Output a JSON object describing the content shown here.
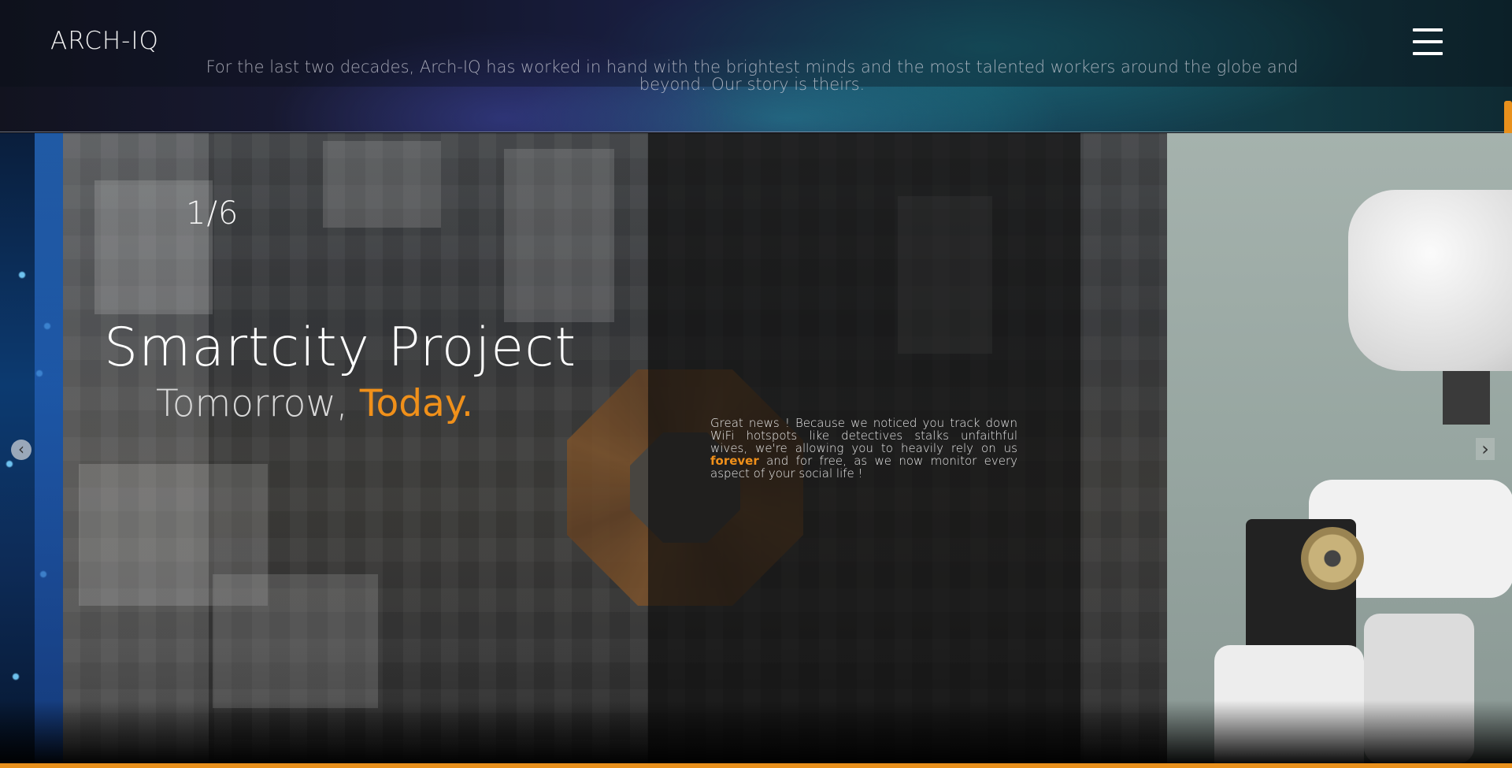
{
  "header": {
    "logo": "ARCH-IQ",
    "tagline": "For the last two decades, Arch-IQ has worked in hand with the brightest minds and the most talented workers around the globe and beyond. Our story is theirs.",
    "menu_icon": "hamburger-menu-icon"
  },
  "slider": {
    "counter": "1/6",
    "title": "Smartcity Project",
    "subtitle_prefix": "Tomorrow, ",
    "subtitle_accent": "Today.",
    "description_part1": "Great news ! Because we noticed you track down WiFi hotspots like detectives stalks unfaithful wives, we're allowing you to heavily rely on us ",
    "description_accent": "forever",
    "description_part2": " and for free, as we now monitor every aspect of your social life !",
    "prev_icon": "chevron-left-icon",
    "next_icon": "chevron-right-icon",
    "prev_glyph": "‹",
    "next_glyph": "›"
  },
  "colors": {
    "accent": "#f0901a",
    "header_start": "#12131f",
    "header_end": "#0f2a32"
  }
}
